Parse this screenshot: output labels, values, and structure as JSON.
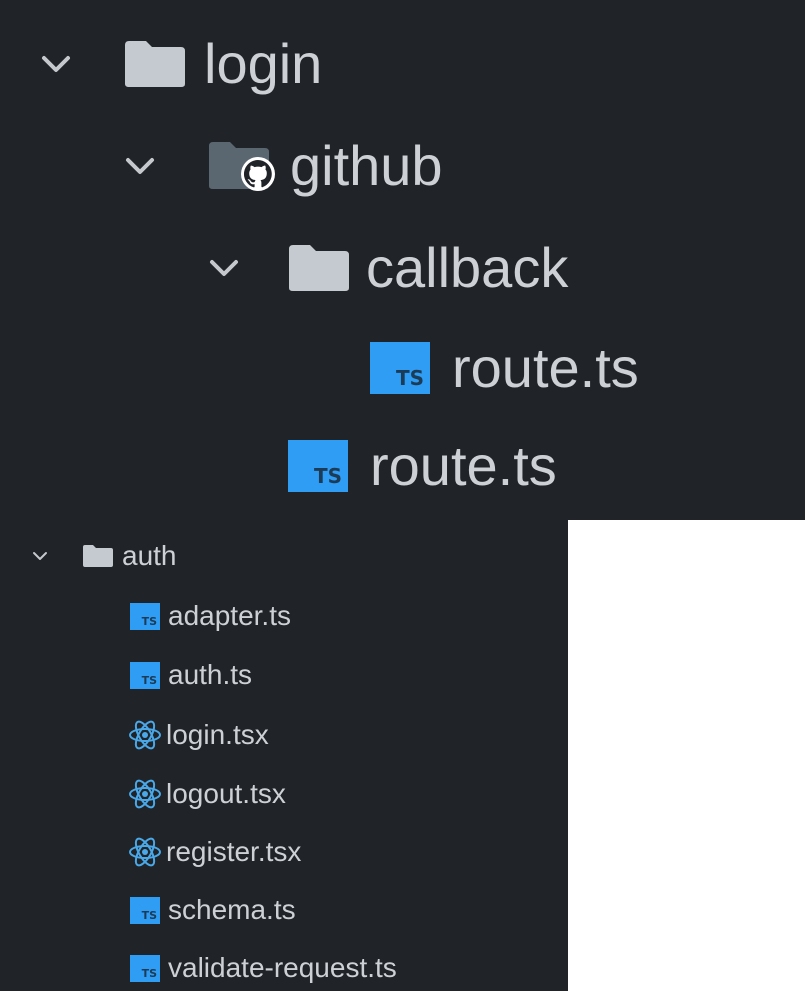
{
  "top_tree": {
    "login_folder": "login",
    "github_folder": "github",
    "callback_folder": "callback",
    "callback_route_file": "route.ts",
    "github_route_file": "route.ts",
    "ts_badge": "TS"
  },
  "bottom_tree": {
    "auth_folder": "auth",
    "ts_badge": "TS",
    "files": [
      {
        "label": "adapter.ts",
        "type": "ts"
      },
      {
        "label": "auth.ts",
        "type": "ts"
      },
      {
        "label": "login.tsx",
        "type": "tsx"
      },
      {
        "label": "logout.tsx",
        "type": "tsx"
      },
      {
        "label": "register.tsx",
        "type": "tsx"
      },
      {
        "label": "schema.ts",
        "type": "ts"
      },
      {
        "label": "validate-request.ts",
        "type": "ts"
      }
    ]
  },
  "colors": {
    "background": "#202327",
    "text": "#cdd1d6",
    "folder_icon": "#c5c9d0",
    "ts_badge": "#2f9df4",
    "react_icon": "#4aa8e8"
  },
  "icons": [
    "chevron-down-icon",
    "folder-icon",
    "github-folder-icon",
    "typescript-file-icon",
    "react-file-icon"
  ]
}
